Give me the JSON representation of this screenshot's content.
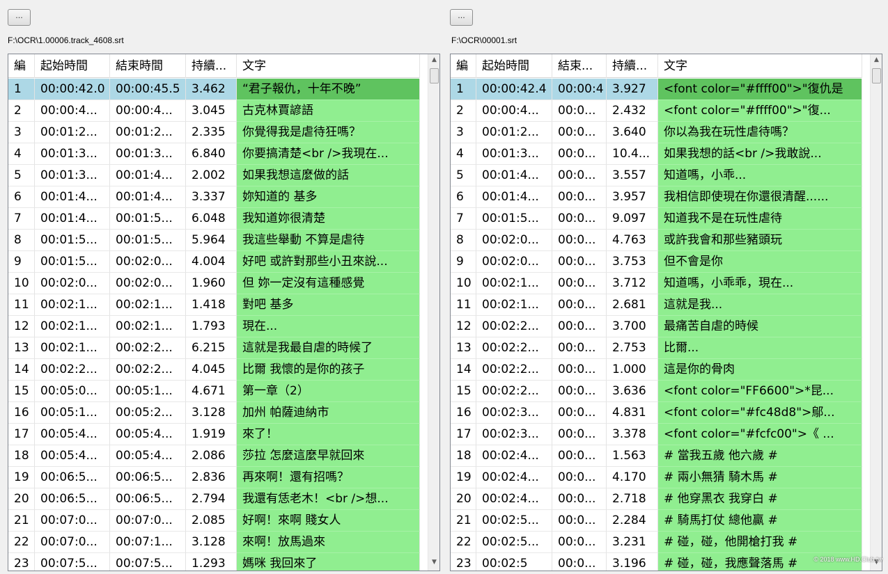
{
  "panels": [
    {
      "browse_label": "...",
      "path": "F:\\OCR\\1.00006.track_4608.srt",
      "columns": [
        "編",
        "起始時間",
        "結束時間",
        "持續...",
        "文字"
      ],
      "rows": [
        [
          "1",
          "00:00:42.0",
          "00:00:45.5",
          "3.462",
          "“君子報仇，十年不晚”"
        ],
        [
          "2",
          "00:00:4...",
          "00:00:4...",
          "3.045",
          "古克林賈諺語"
        ],
        [
          "3",
          "00:01:2...",
          "00:01:2...",
          "2.335",
          "你覺得我是虐待狂嗎？"
        ],
        [
          "4",
          "00:01:3...",
          "00:01:3...",
          "6.840",
          "你要搞清楚<br />我現在..."
        ],
        [
          "5",
          "00:01:3...",
          "00:01:4...",
          "2.002",
          "如果我想這麼做的話"
        ],
        [
          "6",
          "00:01:4...",
          "00:01:4...",
          "3.337",
          "妳知道的 基多"
        ],
        [
          "7",
          "00:01:4...",
          "00:01:5...",
          "6.048",
          "我知道妳很清楚"
        ],
        [
          "8",
          "00:01:5...",
          "00:01:5...",
          "5.964",
          "我這些舉動 不算是虐待"
        ],
        [
          "9",
          "00:01:5...",
          "00:02:0...",
          "4.004",
          "好吧 或許對那些小丑來說..."
        ],
        [
          "10",
          "00:02:0...",
          "00:02:0...",
          "1.960",
          "但 妳一定沒有這種感覺"
        ],
        [
          "11",
          "00:02:1...",
          "00:02:1...",
          "1.418",
          "對吧 基多"
        ],
        [
          "12",
          "00:02:1...",
          "00:02:1...",
          "1.793",
          "現在..."
        ],
        [
          "13",
          "00:02:1...",
          "00:02:2...",
          "6.215",
          "這就是我最自虐的時候了"
        ],
        [
          "14",
          "00:02:2...",
          "00:02:2...",
          "4.045",
          "比爾 我懷的是你的孩子"
        ],
        [
          "15",
          "00:05:0...",
          "00:05:1...",
          "4.671",
          "第一章（2）"
        ],
        [
          "16",
          "00:05:1...",
          "00:05:2...",
          "3.128",
          "加州 帕薩迪納市"
        ],
        [
          "17",
          "00:05:4...",
          "00:05:4...",
          "1.919",
          "來了！"
        ],
        [
          "18",
          "00:05:4...",
          "00:05:4...",
          "2.086",
          "莎拉 怎麼這麼早就回來"
        ],
        [
          "19",
          "00:06:5...",
          "00:06:5...",
          "2.836",
          "再來啊！還有招嗎？"
        ],
        [
          "20",
          "00:06:5...",
          "00:06:5...",
          "2.794",
          "我還有恁老木！<br />想..."
        ],
        [
          "21",
          "00:07:0...",
          "00:07:0...",
          "2.085",
          "好啊！來啊 賤女人"
        ],
        [
          "22",
          "00:07:0...",
          "00:07:1...",
          "3.128",
          "來啊！放馬過來"
        ],
        [
          "23",
          "00:07:5...",
          "00:07:5...",
          "1.293",
          "媽咪 我回來了"
        ]
      ]
    },
    {
      "browse_label": "...",
      "path": "F:\\OCR\\00001.srt",
      "columns": [
        "編",
        "起始時間",
        "結束...",
        "持續...",
        "文字"
      ],
      "rows": [
        [
          "1",
          "00:00:42.4",
          "00:00:4",
          "3.927",
          "<font color=\"#ffff00\">\"復仇是"
        ],
        [
          "2",
          "00:00:4...",
          "00:0...",
          "2.432",
          "<font color=\"#ffff00\">\"復..."
        ],
        [
          "3",
          "00:01:2...",
          "00:0...",
          "3.640",
          "你以為我在玩性虐待嗎？"
        ],
        [
          "4",
          "00:01:3...",
          "00:0...",
          "10.4...",
          "如果我想的話<br />我敢說..."
        ],
        [
          "5",
          "00:01:4...",
          "00:0...",
          "3.557",
          "知道嗎，小乖..."
        ],
        [
          "6",
          "00:01:4...",
          "00:0...",
          "3.957",
          "我相信即使現在你還很清醒......"
        ],
        [
          "7",
          "00:01:5...",
          "00:0...",
          "9.097",
          "知道我不是在玩性虐待"
        ],
        [
          "8",
          "00:02:0...",
          "00:0...",
          "4.763",
          "或許我會和那些豬頭玩"
        ],
        [
          "9",
          "00:02:0...",
          "00:0...",
          "3.753",
          "但不會是你"
        ],
        [
          "10",
          "00:02:1...",
          "00:0...",
          "3.712",
          "知道嗎，小乖乖，現在..."
        ],
        [
          "11",
          "00:02:1...",
          "00:0...",
          "2.681",
          "這就是我..."
        ],
        [
          "12",
          "00:02:2...",
          "00:0...",
          "3.700",
          "最痛苦自虐的時候"
        ],
        [
          "13",
          "00:02:2...",
          "00:0...",
          "2.753",
          "比爾..."
        ],
        [
          "14",
          "00:02:2...",
          "00:0...",
          "1.000",
          "這是你的骨肉"
        ],
        [
          "15",
          "00:02:2...",
          "00:0...",
          "3.636",
          "<font color=\"FF6600\">*昆..."
        ],
        [
          "16",
          "00:02:3...",
          "00:0...",
          "4.831",
          "<font color=\"#fc48d8\">鄔..."
        ],
        [
          "17",
          "00:02:3...",
          "00:0...",
          "3.378",
          "<font color=\"#fcfc00\">《 ..."
        ],
        [
          "18",
          "00:02:4...",
          "00:0...",
          "1.563",
          "# 當我五歲 他六歲 #"
        ],
        [
          "19",
          "00:02:4...",
          "00:0...",
          "4.170",
          "# 兩小無猜 騎木馬 #"
        ],
        [
          "20",
          "00:02:4...",
          "00:0...",
          "2.718",
          "# 他穿黑衣 我穿白 #"
        ],
        [
          "21",
          "00:02:5...",
          "00:0...",
          "2.284",
          "# 騎馬打仗 總他贏 #"
        ],
        [
          "22",
          "00:02:5...",
          "00:0...",
          "3.231",
          "# 碰，碰，他開槍打我 #"
        ],
        [
          "23",
          "00:02:5",
          "00:0...",
          "3.196",
          "# 碰，碰，我應聲落馬 #"
        ]
      ]
    }
  ],
  "scroll_up_glyph": "▲",
  "scroll_down_glyph": "▼",
  "watermark": "© 2018 www.HD.Club.tw",
  "selected_row": "1"
}
